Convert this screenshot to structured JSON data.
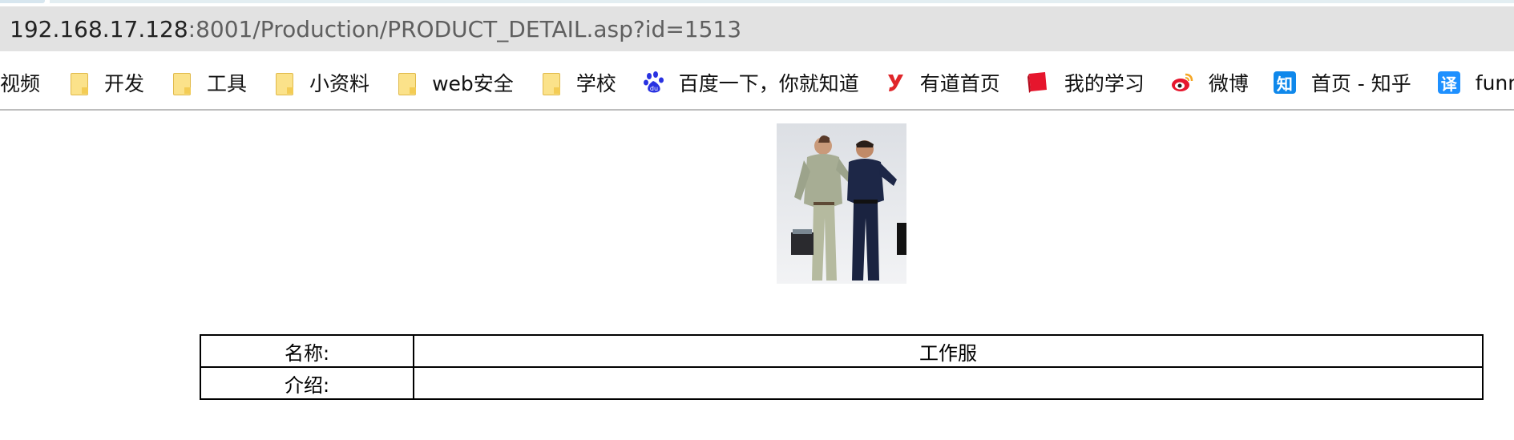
{
  "browser": {
    "url_host": "192.168.17.128",
    "url_path": ":8001/Production/PRODUCT_DETAIL.asp?id=1513"
  },
  "bookmarks": [
    {
      "label": "视频",
      "icon": "none"
    },
    {
      "label": "开发",
      "icon": "folder-icon"
    },
    {
      "label": "工具",
      "icon": "folder-icon"
    },
    {
      "label": "小资料",
      "icon": "folder-icon"
    },
    {
      "label": "web安全",
      "icon": "folder-icon"
    },
    {
      "label": "学校",
      "icon": "folder-icon"
    },
    {
      "label": "百度一下，你就知道",
      "icon": "baidu-paw-icon"
    },
    {
      "label": "有道首页",
      "icon": "youdao-icon"
    },
    {
      "label": "我的学习",
      "icon": "red-book-icon"
    },
    {
      "label": "微博",
      "icon": "weibo-icon"
    },
    {
      "label": "首页 - 知乎",
      "icon": "zhihu-icon",
      "badge_text": "知"
    },
    {
      "label": "funny",
      "icon": "translate-icon",
      "badge_text": "译"
    }
  ],
  "product": {
    "name_label": "名称:",
    "name_value": "工作服",
    "intro_label": "介绍:",
    "intro_value": ""
  },
  "colors": {
    "folder": "#fbe28a",
    "baidu": "#2932e1",
    "youdao": "#e0262a",
    "weibo": "#e6162d",
    "zhihu": "#0f88eb",
    "translate": "#1e90ff"
  }
}
